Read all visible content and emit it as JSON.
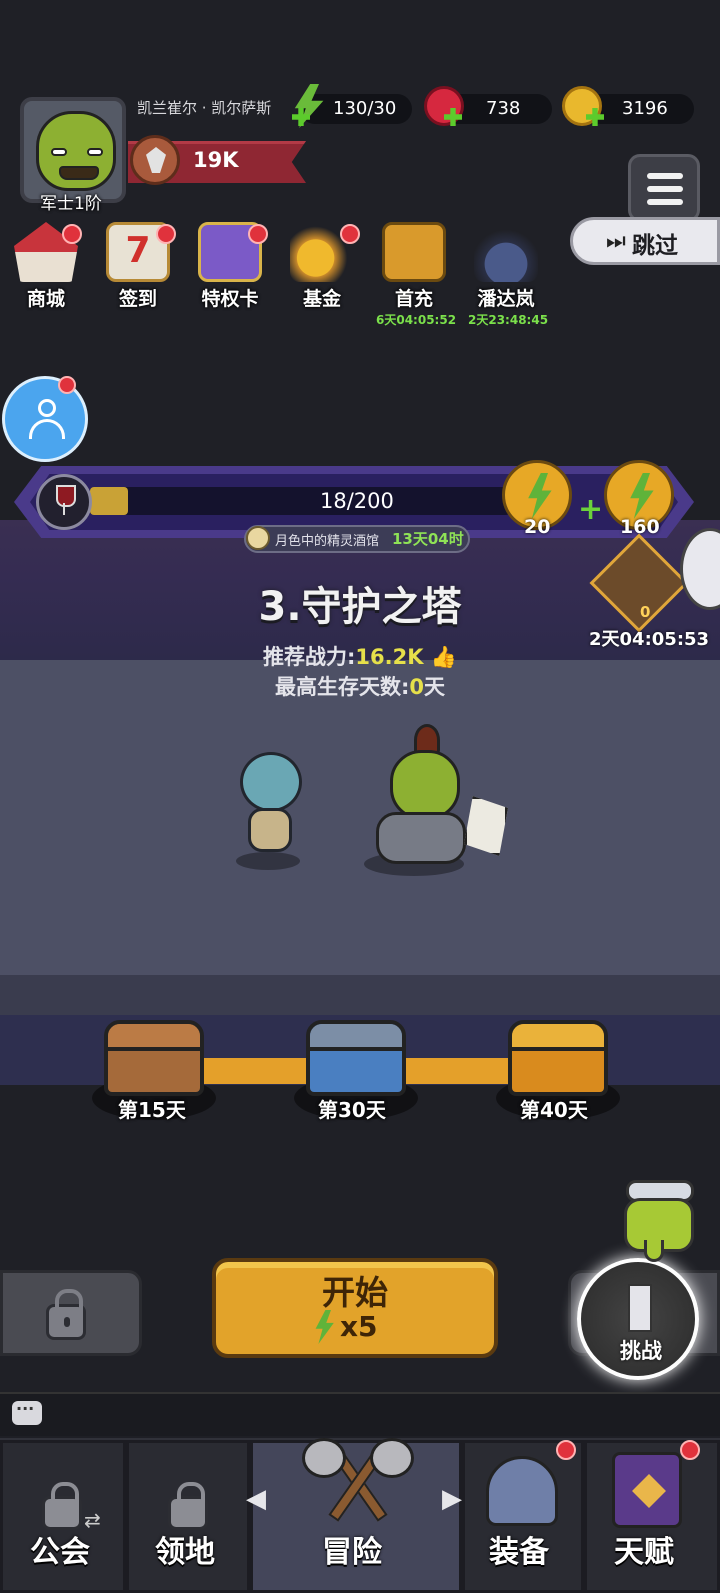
{
  "player": {
    "name": "凯兰崔尔 · 凯尔萨斯",
    "rank": "军士1阶",
    "power": "19K"
  },
  "resources": {
    "energy": "130/30",
    "gems": "738",
    "gold": "3196"
  },
  "top_buttons": {
    "skip": "跳过"
  },
  "features": [
    {
      "label": "商城",
      "icon": "shop-tent-icon",
      "badge": true
    },
    {
      "label": "签到",
      "icon": "calendar-7-icon",
      "badge": true
    },
    {
      "label": "特权卡",
      "icon": "vip-card-icon",
      "badge": true
    },
    {
      "label": "基金",
      "icon": "coin-stack-icon",
      "badge": true
    },
    {
      "label": "首充",
      "icon": "treasure-chest-icon",
      "timer": "6天04:05:52"
    },
    {
      "label": "潘达岚",
      "icon": "samurai-helmet-icon",
      "timer": "2天23:48:45"
    }
  ],
  "event": {
    "progress_text": "18/200",
    "progress_fraction": 0.09,
    "reward_a": "20",
    "reward_b": "160",
    "name": "月色中的精灵酒馆",
    "time_left": "13天04时"
  },
  "fish_event": {
    "count": "0",
    "timer": "2天04:05:53"
  },
  "stage": {
    "title": "3.守护之塔",
    "recommended_label": "推荐战力:",
    "recommended_value": "16.2K",
    "best_days_label": "最高生存天数:",
    "best_days_value": "0",
    "best_days_unit": "天"
  },
  "chests": [
    {
      "label": "第15天",
      "type": "wood"
    },
    {
      "label": "第30天",
      "type": "steel"
    },
    {
      "label": "第40天",
      "type": "gold"
    }
  ],
  "actions": {
    "start_label": "开始",
    "start_cost": "x5",
    "challenge_label": "挑战"
  },
  "nav": [
    {
      "label": "公会",
      "locked": true
    },
    {
      "label": "领地",
      "locked": true
    },
    {
      "label": "冒险",
      "active": true
    },
    {
      "label": "装备",
      "badge": true
    },
    {
      "label": "天赋",
      "badge": true
    }
  ],
  "colors": {
    "accent_gold": "#e2a32a",
    "accent_green": "#7be04b",
    "badge_red": "#e0323c",
    "event_purple": "#4a3a8a"
  }
}
